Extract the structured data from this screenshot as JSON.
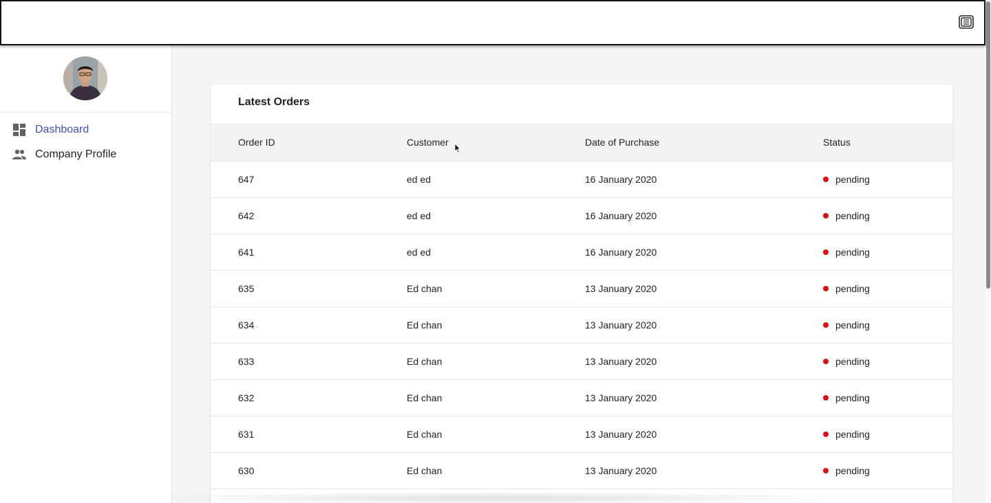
{
  "topbar": {
    "icon": "window-toggle-icon"
  },
  "sidebar": {
    "avatar": "user-avatar",
    "items": [
      {
        "label": "Dashboard",
        "icon": "dashboard-icon",
        "active": true
      },
      {
        "label": "Company Profile",
        "icon": "people-icon",
        "active": false
      }
    ]
  },
  "card": {
    "title": "Latest Orders",
    "columns": [
      "Order ID",
      "Customer",
      "Date of Purchase",
      "Status"
    ],
    "rows": [
      {
        "id": "647",
        "customer": "ed ed",
        "date": "16 January 2020",
        "status": "pending"
      },
      {
        "id": "642",
        "customer": "ed ed",
        "date": "16 January 2020",
        "status": "pending"
      },
      {
        "id": "641",
        "customer": "ed ed",
        "date": "16 January 2020",
        "status": "pending"
      },
      {
        "id": "635",
        "customer": "Ed chan",
        "date": "13 January 2020",
        "status": "pending"
      },
      {
        "id": "634",
        "customer": "Ed chan",
        "date": "13 January 2020",
        "status": "pending"
      },
      {
        "id": "633",
        "customer": "Ed chan",
        "date": "13 January 2020",
        "status": "pending"
      },
      {
        "id": "632",
        "customer": "Ed chan",
        "date": "13 January 2020",
        "status": "pending"
      },
      {
        "id": "631",
        "customer": "Ed chan",
        "date": "13 January 2020",
        "status": "pending"
      },
      {
        "id": "630",
        "customer": "Ed chan",
        "date": "13 January 2020",
        "status": "pending"
      }
    ]
  },
  "colors": {
    "accent": "#3f51b5",
    "status_pending": "#e01010",
    "header_bg": "#f3f3f3"
  }
}
